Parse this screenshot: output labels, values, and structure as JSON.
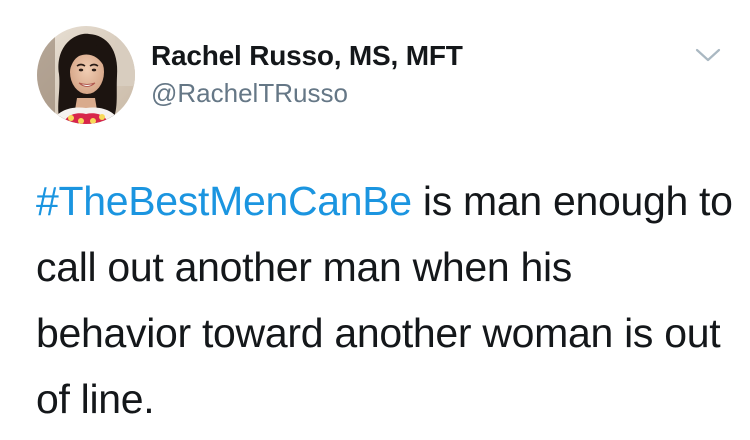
{
  "tweet": {
    "author": {
      "display_name": "Rachel Russo, MS, MFT",
      "handle": "@RachelTRusso"
    },
    "menu_icon": "chevron-down-icon",
    "text": {
      "hashtag": "#TheBestMenCanBe",
      "rest": " is man enough to call out another man when his behavior toward another woman is out of line."
    }
  },
  "colors": {
    "hashtag": "#1b95e0",
    "text": "#14171a",
    "handle": "#657786",
    "chevron": "#aab8c2"
  }
}
